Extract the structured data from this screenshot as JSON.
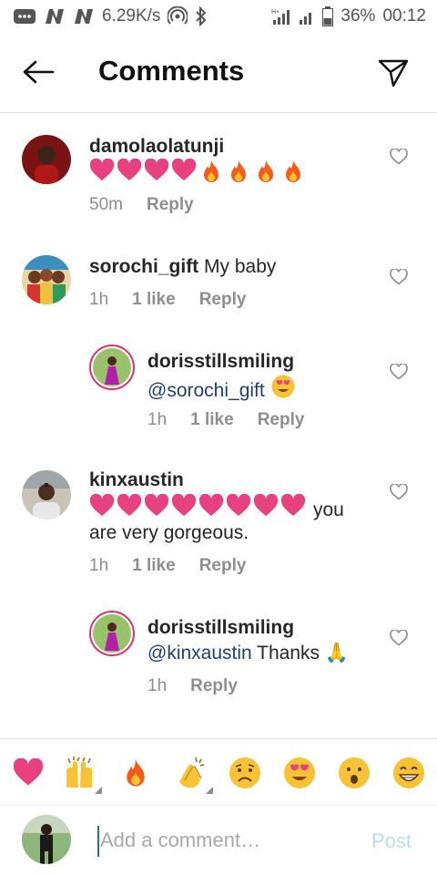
{
  "status_bar": {
    "network_speed": "6.29K/s",
    "battery": "36%",
    "time": "00:12",
    "icons": [
      "message-icon",
      "n-icon",
      "n-icon",
      "hotspot-icon",
      "bluetooth-icon",
      "signal-icon",
      "signal-icon",
      "battery-icon"
    ]
  },
  "header": {
    "title": "Comments"
  },
  "comments": [
    {
      "username": "damolaolatunji",
      "emoji_text": [
        "heart",
        "heart",
        "heart",
        "heart",
        "fire",
        "fire",
        "fire",
        "fire"
      ],
      "time": "50m",
      "likes": "",
      "reply": "Reply"
    },
    {
      "username": "sorochi_gift",
      "text": "My baby",
      "time": "1h",
      "likes": "1 like",
      "reply": "Reply"
    },
    {
      "username": "dorisstillsmiling",
      "mention": "@sorochi_gift",
      "time": "1h",
      "likes": "1 like",
      "reply": "Reply"
    },
    {
      "username": "kinxaustin",
      "text_a": "you",
      "text_b": "are very gorgeous.",
      "time": "1h",
      "likes": "1 like",
      "reply": "Reply"
    },
    {
      "username": "dorisstillsmiling",
      "mention": "@kinxaustin",
      "text": "Thanks 🙏",
      "time": "1h",
      "reply": "Reply"
    }
  ],
  "emoji_bar": [
    "heart",
    "raised-hands",
    "fire",
    "clapping-hands",
    "sad-face",
    "heart-eyes",
    "surprised-face",
    "grinning-face"
  ],
  "composer": {
    "placeholder": "Add a comment…",
    "post_label": "Post"
  },
  "colors": {
    "heart": "#e8417f",
    "fire": "#f45c1c",
    "mention": "#1f3f77",
    "post": "#b8dcf8",
    "story_ring": "#e1306c"
  }
}
